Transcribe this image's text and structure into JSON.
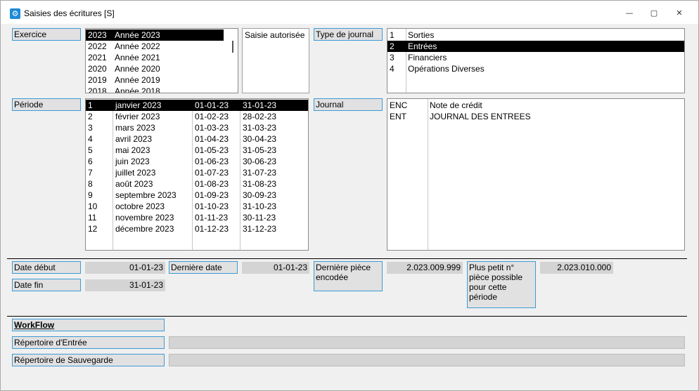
{
  "window": {
    "title": "Saisies des écritures [S]",
    "app_icon": "app-icon",
    "min_icon": "minimize-icon",
    "max_icon": "maximize-icon",
    "close_icon": "close-icon",
    "min_glyph": "—",
    "max_glyph": "▢",
    "close_glyph": "✕"
  },
  "labels": {
    "exercice": "Exercice",
    "saisie_autorisee": "Saisie autorisée",
    "type_journal": "Type de journal",
    "periode": "Période",
    "journal": "Journal",
    "date_debut": "Date début",
    "date_fin": "Date fin",
    "derniere_date": "Dernière date",
    "derniere_piece": "Dernière  pièce encodée",
    "plus_petit": "Plus petit n° pièce possible pour cette période",
    "workflow": "WorkFlow",
    "repertoire_entree": "Répertoire d'Entrée",
    "repertoire_sauvegarde": "Répertoire de Sauvegarde"
  },
  "values": {
    "date_debut": "01-01-23",
    "date_fin": "31-01-23",
    "derniere_date": "01-01-23",
    "derniere_piece": "2.023.009.999",
    "plus_petit": "2.023.010.000",
    "repertoire_entree": "",
    "repertoire_sauvegarde": ""
  },
  "exercices": [
    {
      "year": "2023",
      "label": "Année 2023",
      "selected": true
    },
    {
      "year": "2022",
      "label": "Année 2022"
    },
    {
      "year": "2021",
      "label": "Année 2021"
    },
    {
      "year": "2020",
      "label": "Année 2020"
    },
    {
      "year": "2019",
      "label": "Année 2019"
    },
    {
      "year": "2018",
      "label": "Année 2018"
    }
  ],
  "types_journal": [
    {
      "code": "1",
      "label": "Sorties"
    },
    {
      "code": "2",
      "label": "Entrées",
      "selected": true
    },
    {
      "code": "3",
      "label": "Financiers"
    },
    {
      "code": "4",
      "label": "Opérations Diverses"
    }
  ],
  "periodes": [
    {
      "num": "1",
      "label": "janvier 2023",
      "start": "01-01-23",
      "end": "31-01-23",
      "selected": true
    },
    {
      "num": "2",
      "label": "février 2023",
      "start": "01-02-23",
      "end": "28-02-23"
    },
    {
      "num": "3",
      "label": "mars 2023",
      "start": "01-03-23",
      "end": "31-03-23"
    },
    {
      "num": "4",
      "label": "avril 2023",
      "start": "01-04-23",
      "end": "30-04-23"
    },
    {
      "num": "5",
      "label": "mai 2023",
      "start": "01-05-23",
      "end": "31-05-23"
    },
    {
      "num": "6",
      "label": "juin 2023",
      "start": "01-06-23",
      "end": "30-06-23"
    },
    {
      "num": "7",
      "label": "juillet 2023",
      "start": "01-07-23",
      "end": "31-07-23"
    },
    {
      "num": "8",
      "label": "août 2023",
      "start": "01-08-23",
      "end": "31-08-23"
    },
    {
      "num": "9",
      "label": "septembre 2023",
      "start": "01-09-23",
      "end": "30-09-23"
    },
    {
      "num": "10",
      "label": "octobre 2023",
      "start": "01-10-23",
      "end": "31-10-23"
    },
    {
      "num": "11",
      "label": "novembre 2023",
      "start": "01-11-23",
      "end": "30-11-23"
    },
    {
      "num": "12",
      "label": "décembre 2023",
      "start": "01-12-23",
      "end": "31-12-23"
    }
  ],
  "journaux": [
    {
      "code": "ENC",
      "label": "Note de crédit"
    },
    {
      "code": "ENT",
      "label": "JOURNAL DES ENTREES"
    }
  ]
}
